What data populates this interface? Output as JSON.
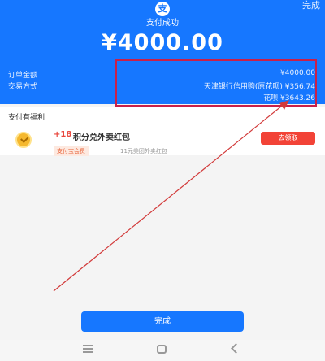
{
  "header": {
    "done_top": "完成",
    "logo_char": "支",
    "success_title": "支付成功",
    "amount": "¥4000.00"
  },
  "order": {
    "amount_label": "订单金额",
    "amount_value": "¥4000.00",
    "method_label": "交易方式",
    "method_line1": "天津银行信用购(原花呗) ¥356.74",
    "method_line2": "花呗 ¥3643.26"
  },
  "benefits": {
    "section_title": "支付有福利",
    "plus_points": "+18",
    "title": "积分兑外卖红包",
    "tag": "支付宝会员",
    "desc": "11元美团外卖红包",
    "claim_label": "去领取"
  },
  "footer": {
    "done_label": "完成"
  },
  "colors": {
    "primary": "#1677ff",
    "highlight_box": "#c8204a",
    "claim_button": "#f24337"
  },
  "icons": [
    "alipay-logo-icon",
    "coin-icon",
    "menu-icon",
    "home-icon",
    "back-icon"
  ]
}
